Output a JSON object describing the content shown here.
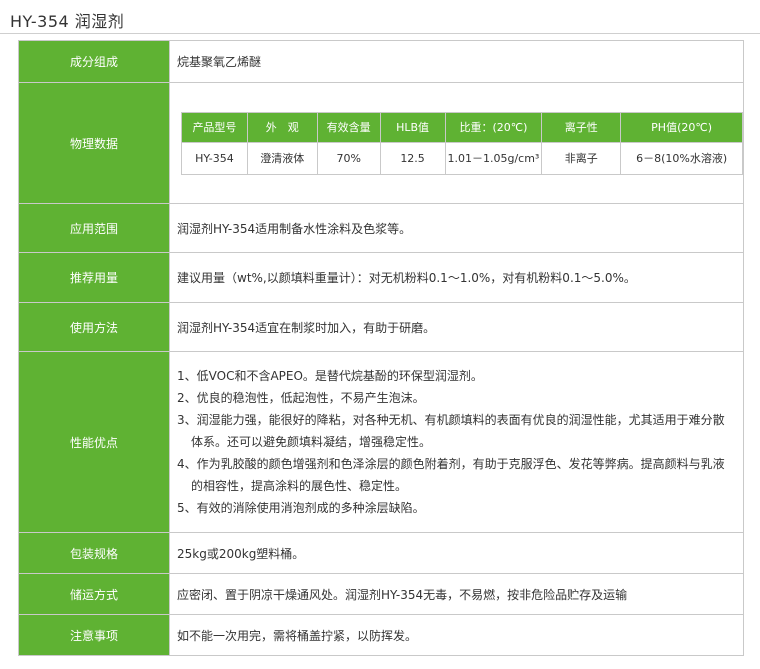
{
  "title": "HY-354 润湿剂",
  "rows": {
    "composition": {
      "label": "成分组成",
      "value": "烷基聚氧乙烯醚"
    },
    "physical": {
      "label": "物理数据",
      "headers": [
        "产品型号",
        "外　观",
        "有效含量",
        "HLB值",
        "比重：(20℃)",
        "离子性",
        "PH值(20℃)"
      ],
      "values": [
        "HY-354",
        "澄清液体",
        "70%",
        "12.5",
        "1.01－1.05g/cm³",
        "非离子",
        "6－8(10%水溶液)"
      ]
    },
    "application": {
      "label": "应用范围",
      "value": "润湿剂HY-354适用制备水性涂料及色浆等。"
    },
    "dosage": {
      "label": "推荐用量",
      "value": "建议用量（wt%,以颜填料重量计）：对无机粉料0.1～1.0%，对有机粉料0.1～5.0%。"
    },
    "usage": {
      "label": "使用方法",
      "value": "润湿剂HY-354适宜在制浆时加入，有助于研磨。"
    },
    "advantages": {
      "label": "性能优点",
      "items": [
        "1、低VOC和不含APEO。是替代烷基酚的环保型润湿剂。",
        "2、优良的稳泡性，低起泡性，不易产生泡沫。",
        "3、润湿能力强，能很好的降粘，对各种无机、有机颜填料的表面有优良的润湿性能，尤其适用于难分散体系。还可以避免颜填料凝结，增强稳定性。",
        "4、作为乳胶酸的颜色增强剂和色泽涂层的颜色附着剂，有助于克服浮色、发花等弊病。提高颜料与乳液的相容性，提高涂料的展色性、稳定性。",
        "5、有效的消除使用消泡剂成的多种涂层缺陷。"
      ]
    },
    "packaging": {
      "label": "包装规格",
      "value": "25kg或200kg塑料桶。"
    },
    "storage": {
      "label": "储运方式",
      "value": "应密闭、置于阴凉干燥通风处。润湿剂HY-354无毒，不易燃，按非危险品贮存及运输"
    },
    "notes": {
      "label": "注意事项",
      "value": "如不能一次用完，需将桶盖拧紧，以防挥发。"
    }
  }
}
